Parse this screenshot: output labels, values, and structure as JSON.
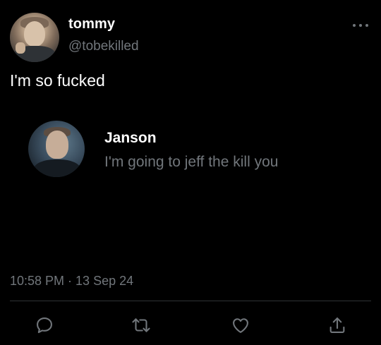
{
  "author": {
    "display_name": "tommy",
    "handle": "@tobekilled"
  },
  "tweet": {
    "text": "I'm so fucked",
    "timestamp": "10:58 PM · 13 Sep 24"
  },
  "quoted": {
    "display_name": "Janson",
    "text": "I'm going to jeff the kill you"
  },
  "icons": {
    "more": "more-horizontal-icon",
    "reply": "reply-icon",
    "retweet": "retweet-icon",
    "like": "heart-icon",
    "share": "share-icon"
  },
  "colors": {
    "background": "#000000",
    "primary_text": "#ffffff",
    "secondary_text": "#71767b",
    "divider": "#2f3336"
  }
}
